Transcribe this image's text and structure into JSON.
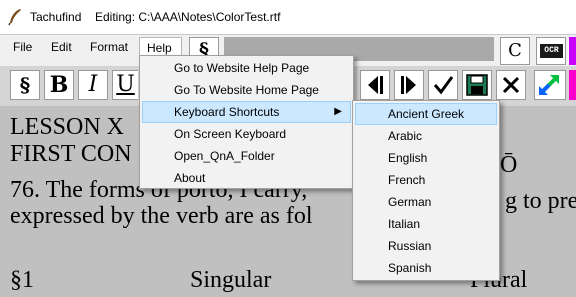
{
  "window": {
    "app_name": "Tachufind",
    "editing_label": "Editing: C:\\AAA\\Notes\\ColorTest.rtf",
    "icon": "quill-pen-icon"
  },
  "menubar": {
    "items": [
      "File",
      "Edit",
      "Format",
      "Help"
    ],
    "section_symbol": "§",
    "c_label": "C",
    "ocr_label": "OCR"
  },
  "toolbar": {
    "section_symbol": "§",
    "bold": "B",
    "italic": "I",
    "underline": "U",
    "icons": [
      "arrow-left-bar-icon",
      "arrow-right-bar-icon",
      "checkmark-icon",
      "save-icon",
      "close-x-icon",
      "resize-diagonal-arrows-icon"
    ]
  },
  "document": {
    "lines": [
      "LESSON X",
      "FIRST CON",
      "76. The forms of porto, I carry,",
      "expressed by the verb are as fol",
      "§1"
    ],
    "tail_line3": "Ō",
    "tail_line4": "g to pre",
    "col_singular": "Singular",
    "col_plural": "Plural"
  },
  "help_menu": {
    "items": [
      "Go to Website Help Page",
      "Go To Website Home Page",
      "Keyboard Shortcuts",
      "On Screen Keyboard",
      "Open_QnA_Folder",
      "About"
    ],
    "submenu_arrow": "▶"
  },
  "language_menu": {
    "items": [
      "Ancient Greek",
      "Arabic",
      "English",
      "French",
      "German",
      "Italian",
      "Russian",
      "Spanish"
    ]
  },
  "colors": {
    "highlight": "#cce8ff",
    "highlight_border": "#99d1ff",
    "resize_icon_blue": "#0a62ff",
    "resize_icon_green": "#00c040",
    "accent_purple": "#c800ff",
    "accent_pink": "#ff00cc"
  }
}
